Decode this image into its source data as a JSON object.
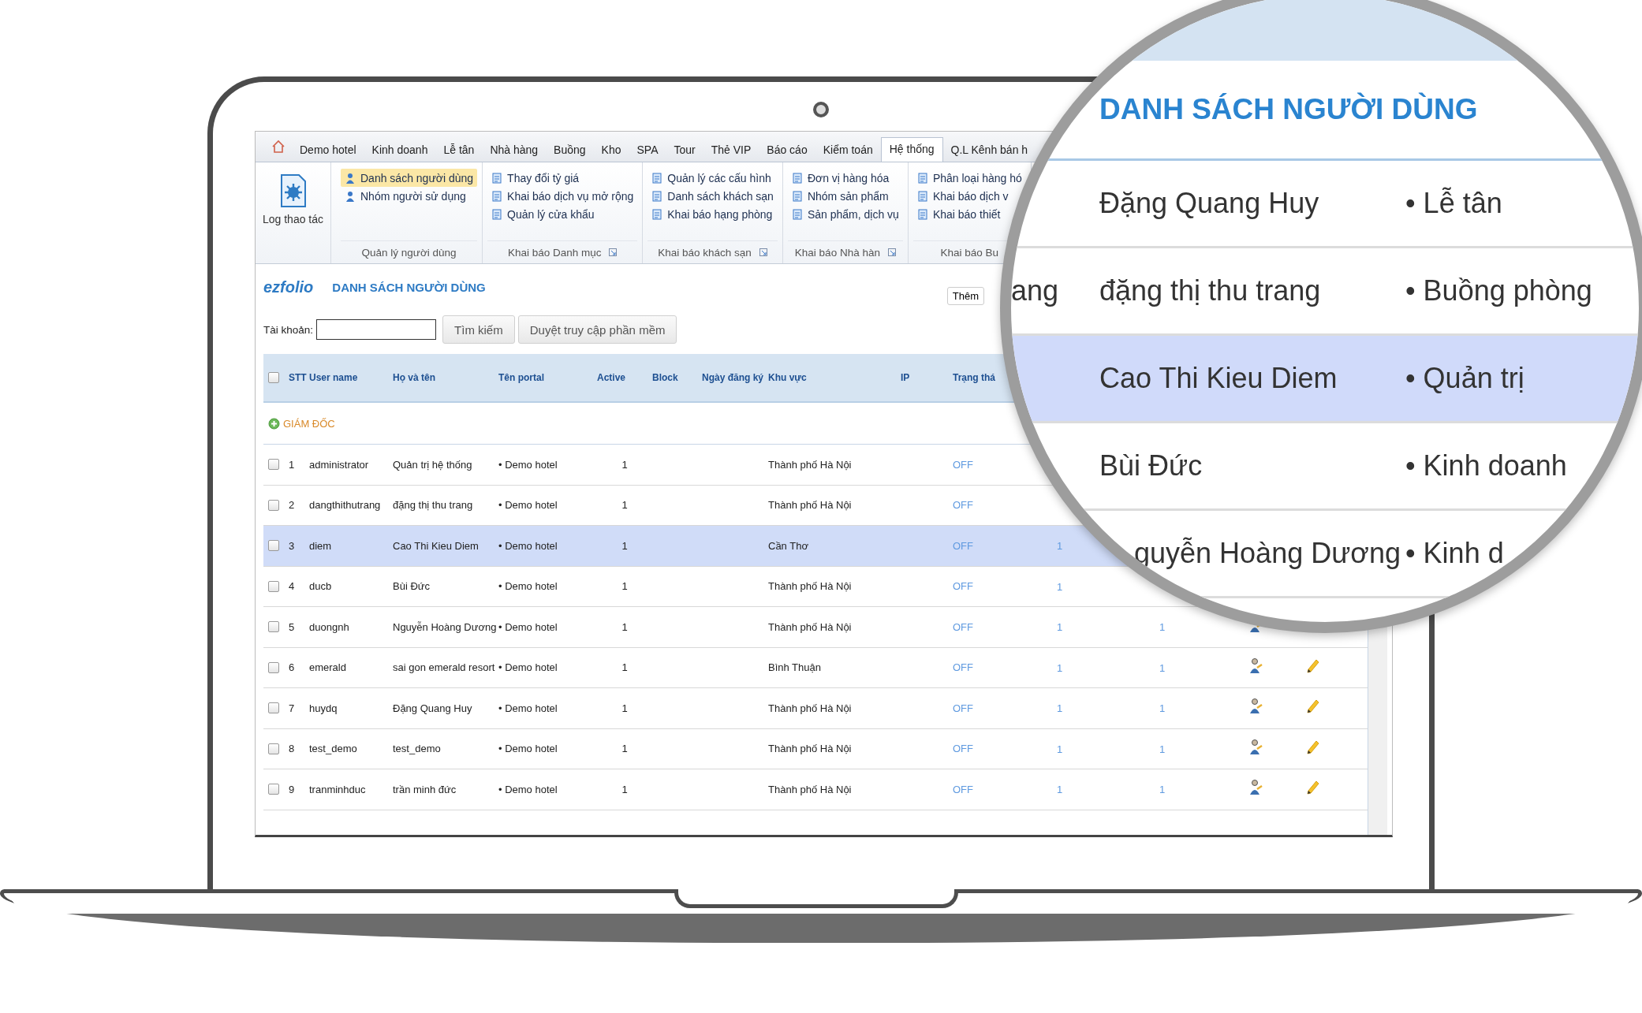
{
  "menu_tabs": [
    {
      "label": "Demo hotel",
      "selected": false
    },
    {
      "label": "Kinh doanh",
      "selected": false
    },
    {
      "label": "Lễ tân",
      "selected": false
    },
    {
      "label": "Nhà hàng",
      "selected": false
    },
    {
      "label": "Buồng",
      "selected": false
    },
    {
      "label": "Kho",
      "selected": false
    },
    {
      "label": "SPA",
      "selected": false
    },
    {
      "label": "Tour",
      "selected": false
    },
    {
      "label": "Thẻ VIP",
      "selected": false
    },
    {
      "label": "Báo cáo",
      "selected": false
    },
    {
      "label": "Kiểm toán",
      "selected": false
    },
    {
      "label": "Hệ thống",
      "selected": true
    },
    {
      "label": "Q.L Kênh bán h",
      "selected": false
    }
  ],
  "ribbon": {
    "big_button": "Log thao tác",
    "groups": [
      {
        "label": "Quản lý người dùng",
        "launcher": false,
        "items": [
          {
            "label": "Danh sách người dùng",
            "selected": true
          },
          {
            "label": "Nhóm người sử dụng",
            "selected": false
          }
        ]
      },
      {
        "label": "Khai báo Danh mục",
        "launcher": true,
        "items": [
          {
            "label": "Thay đổi tỷ giá",
            "selected": false
          },
          {
            "label": "Khai báo dịch vụ mở rộng",
            "selected": false
          },
          {
            "label": "Quản lý cửa khẩu",
            "selected": false
          }
        ]
      },
      {
        "label": "Khai báo khách sạn",
        "launcher": true,
        "items": [
          {
            "label": "Quản lý các cấu hình",
            "selected": false
          },
          {
            "label": "Danh sách khách sạn",
            "selected": false
          },
          {
            "label": "Khai báo hạng phòng",
            "selected": false
          }
        ]
      },
      {
        "label": "Khai báo Nhà hàn",
        "launcher": true,
        "items": [
          {
            "label": "Đơn vị hàng hóa",
            "selected": false
          },
          {
            "label": "Nhóm sản phẩm",
            "selected": false
          },
          {
            "label": "Sản phẩm, dịch vụ",
            "selected": false
          }
        ]
      },
      {
        "label": "Khai báo Bu",
        "launcher": false,
        "items": [
          {
            "label": "Phân loại hàng hó",
            "selected": false
          },
          {
            "label": "Khai báo dịch v",
            "selected": false
          },
          {
            "label": "Khai báo thiết",
            "selected": false
          }
        ]
      }
    ]
  },
  "page": {
    "logo": "ezfolio",
    "title": "DANH SÁCH NGƯỜI DÙNG",
    "add_button": "Thêm"
  },
  "search": {
    "label": "Tài khoản:",
    "buttons": [
      "Tìm kiếm",
      "Duyệt truy cập phần mềm"
    ]
  },
  "table": {
    "all_checked": false,
    "columns": [
      "STT",
      "User name",
      "Họ và tên",
      "Tên portal",
      "Active",
      "Block",
      "Ngày đăng ký",
      "Khu vực",
      "IP",
      "Trạng thá"
    ],
    "group": "GIÁM ĐỐC",
    "rows": [
      {
        "checked": false,
        "selected": false,
        "stt": "1",
        "user": "administrator",
        "name": "Quản trị hệ thống",
        "portal": "• Demo hotel",
        "active": "1",
        "region": "Thành phố Hà Nội",
        "status": "OFF"
      },
      {
        "checked": false,
        "selected": false,
        "stt": "2",
        "user": "dangthithutrang",
        "name": "đặng thị thu trang",
        "portal": "• Demo hotel",
        "active": "1",
        "region": "Thành phố Hà Nội",
        "status": "OFF"
      },
      {
        "checked": false,
        "selected": true,
        "stt": "3",
        "user": "diem",
        "name": "Cao Thi Kieu Diem",
        "portal": "• Demo hotel",
        "active": "1",
        "region": "Cần Thơ",
        "status": "OFF",
        "column_12": "1"
      },
      {
        "checked": false,
        "selected": false,
        "stt": "4",
        "user": "ducb",
        "name": "Bùi Đức",
        "portal": "• Demo hotel",
        "active": "1",
        "region": "Thành phố Hà Nội",
        "status": "OFF",
        "column_12": "1"
      },
      {
        "checked": false,
        "selected": false,
        "stt": "5",
        "user": "duongnh",
        "name": "Nguyễn Hoàng Dương",
        "portal": "• Demo hotel",
        "active": "1",
        "region": "Thành phố Hà Nội",
        "status": "OFF",
        "column_12": "1",
        "column_13": "1"
      },
      {
        "checked": false,
        "selected": false,
        "stt": "6",
        "user": "emerald",
        "name": "sai gon emerald resort",
        "portal": "• Demo hotel",
        "active": "1",
        "region": "Bình Thuận",
        "status": "OFF",
        "column_12": "1",
        "column_13": "1"
      },
      {
        "checked": false,
        "selected": false,
        "stt": "7",
        "user": "huydq",
        "name": "Đặng Quang Huy",
        "portal": "• Demo hotel",
        "active": "1",
        "region": "Thành phố Hà Nội",
        "status": "OFF",
        "column_12": "1",
        "column_13": "1"
      },
      {
        "checked": false,
        "selected": false,
        "stt": "8",
        "user": "test_demo",
        "name": "test_demo",
        "portal": "• Demo hotel",
        "active": "1",
        "region": "Thành phố Hà Nội",
        "status": "OFF",
        "column_12": "1",
        "column_13": "1"
      },
      {
        "checked": false,
        "selected": false,
        "stt": "9",
        "user": "tranminhduc",
        "name": "trần minh đức",
        "portal": "• Demo hotel",
        "active": "1",
        "region": "Thành phố Hà Nội",
        "status": "OFF",
        "column_12": "1",
        "column_13": "1"
      }
    ]
  },
  "magnifier": {
    "title": "DANH SÁCH NGƯỜI DÙNG",
    "rows": [
      {
        "selected": false,
        "name": "Đặng Quang Huy",
        "portal": "• Lễ tân"
      },
      {
        "selected": false,
        "column_1": "ang",
        "name": "đặng thị thu trang",
        "portal": "• Buồng phòng"
      },
      {
        "selected": true,
        "name": "Cao Thi Kieu Diem",
        "portal": "• Quản trị"
      },
      {
        "selected": false,
        "name": "Bùi Đức",
        "portal": "• Kinh doanh"
      },
      {
        "selected": false,
        "name": "guyễn Hoàng Dương",
        "portal": "• Kinh d"
      }
    ]
  }
}
